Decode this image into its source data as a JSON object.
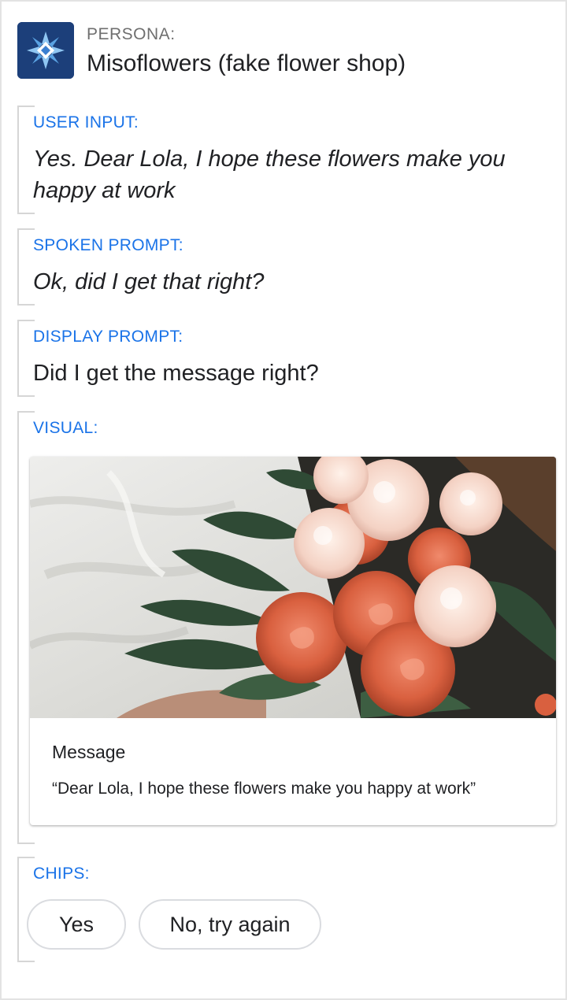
{
  "persona": {
    "label": "PERSONA:",
    "name": "Misoflowers (fake flower shop)",
    "logo_icon": "misoflowers-logo-icon"
  },
  "sections": {
    "user_input": {
      "label": "USER INPUT:",
      "text": "Yes. Dear Lola, I hope these flowers make you happy at work"
    },
    "spoken_prompt": {
      "label": "SPOKEN PROMPT:",
      "text": "Ok, did I get that right?"
    },
    "display_prompt": {
      "label": "DISPLAY PROMPT:",
      "text": "Did I get the message right?"
    },
    "visual": {
      "label": "VISUAL:",
      "card": {
        "image_icon": "flower-bouquet-image",
        "title": "Message",
        "body": "“Dear Lola, I hope these flowers make you happy at work”"
      }
    },
    "chips": {
      "label": "CHIPS:",
      "items": [
        "Yes",
        "No, try again"
      ]
    }
  },
  "colors": {
    "label_blue": "#1a73e8",
    "text_dark": "#202124",
    "persona_gray": "#6f6f6f",
    "bracket_gray": "#d6d6d6",
    "logo_bg": "#1c3f7a"
  }
}
